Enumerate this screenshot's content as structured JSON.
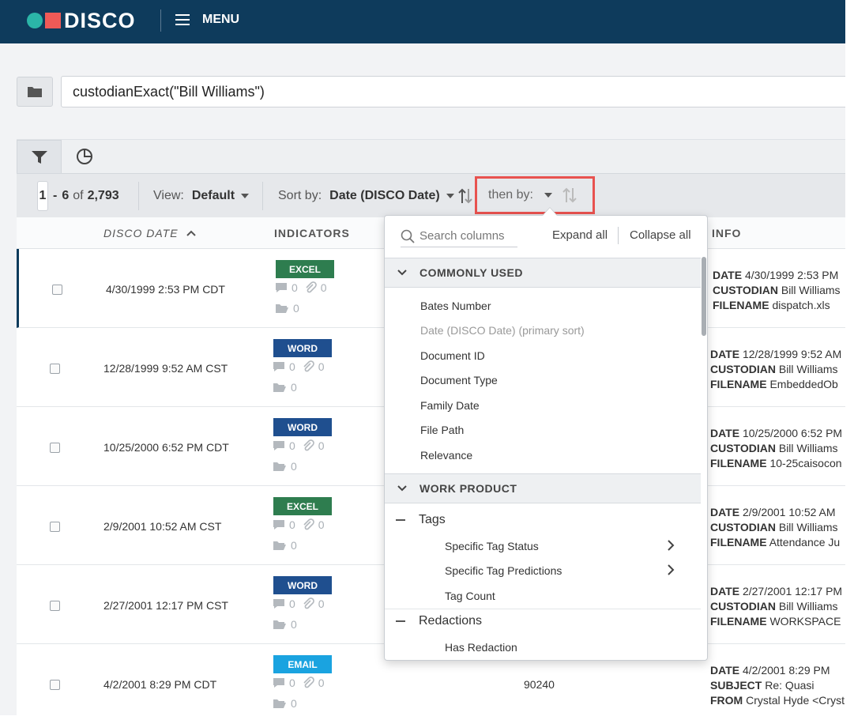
{
  "header": {
    "logo_text": "DISCO",
    "menu_label": "MENU"
  },
  "search": {
    "query": "custodianExact(\"Bill Williams\")"
  },
  "toolbar": {
    "range_start": "1",
    "range_dash": "-",
    "range_end": "6",
    "of_label": "of",
    "total": "2,793",
    "view_label": "View:",
    "view_value": "Default",
    "sort_label": "Sort by:",
    "sort_value": "Date (DISCO Date)",
    "then_by_label": "then by:"
  },
  "columns": {
    "date": "DISCO DATE",
    "indicators": "INDICATORS",
    "info": "INFO"
  },
  "rows": [
    {
      "date": "4/30/1999 2:53 PM CDT",
      "badge": "EXCEL",
      "badge_color": "#2e7d4f",
      "comments": "0",
      "attachments": "0",
      "folders": "0",
      "info": [
        [
          "DATE",
          "4/30/1999 2:53 PM"
        ],
        [
          "CUSTODIAN",
          "Bill Williams"
        ],
        [
          "FILENAME",
          "dispatch.xls"
        ]
      ]
    },
    {
      "date": "12/28/1999 9:52 AM CST",
      "badge": "WORD",
      "badge_color": "#1f4f8f",
      "comments": "0",
      "attachments": "0",
      "folders": "0",
      "info": [
        [
          "DATE",
          "12/28/1999 9:52 AM"
        ],
        [
          "CUSTODIAN",
          "Bill Williams"
        ],
        [
          "FILENAME",
          "EmbeddedOb"
        ]
      ]
    },
    {
      "date": "10/25/2000 6:52 PM CDT",
      "badge": "WORD",
      "badge_color": "#1f4f8f",
      "comments": "0",
      "attachments": "0",
      "folders": "0",
      "info": [
        [
          "DATE",
          "10/25/2000 6:52 PM"
        ],
        [
          "CUSTODIAN",
          "Bill Williams"
        ],
        [
          "FILENAME",
          "10-25caisocon"
        ]
      ]
    },
    {
      "date": "2/9/2001 10:52 AM CST",
      "badge": "EXCEL",
      "badge_color": "#2e7d4f",
      "comments": "0",
      "attachments": "0",
      "folders": "0",
      "info": [
        [
          "DATE",
          "2/9/2001 10:52 AM"
        ],
        [
          "CUSTODIAN",
          "Bill Williams"
        ],
        [
          "FILENAME",
          "Attendance Ju"
        ]
      ]
    },
    {
      "date": "2/27/2001 12:17 PM CST",
      "badge": "WORD",
      "badge_color": "#1f4f8f",
      "comments": "0",
      "attachments": "0",
      "folders": "0",
      "info": [
        [
          "DATE",
          "2/27/2001 12:17 PM"
        ],
        [
          "CUSTODIAN",
          "Bill Williams"
        ],
        [
          "FILENAME",
          "WORKSPACE"
        ]
      ]
    },
    {
      "date": "4/2/2001 8:29 PM CDT",
      "badge": "EMAIL",
      "badge_color": "#1aa3e0",
      "comments": "0",
      "attachments": "0",
      "folders": "0",
      "docnum": "90240",
      "info": [
        [
          "DATE",
          "4/2/2001 8:29 PM"
        ],
        [
          "SUBJECT",
          "Re: Quasi"
        ],
        [
          "FROM",
          "Crystal Hyde <Cryst"
        ]
      ]
    }
  ],
  "dropdown": {
    "search_placeholder": "Search columns",
    "expand_all": "Expand all",
    "collapse_all": "Collapse all",
    "groups": [
      {
        "label": "COMMONLY USED",
        "items": [
          "Bates Number",
          "Date (DISCO Date) (primary sort)",
          "Document ID",
          "Document Type",
          "Family Date",
          "File Path",
          "Relevance"
        ]
      },
      {
        "label": "WORK PRODUCT",
        "subgroups": [
          {
            "label": "Tags",
            "items": [
              "Specific Tag Status",
              "Specific Tag Predictions",
              "Tag Count"
            ]
          },
          {
            "label": "Redactions",
            "items": [
              "Has Redaction"
            ]
          }
        ]
      }
    ]
  }
}
